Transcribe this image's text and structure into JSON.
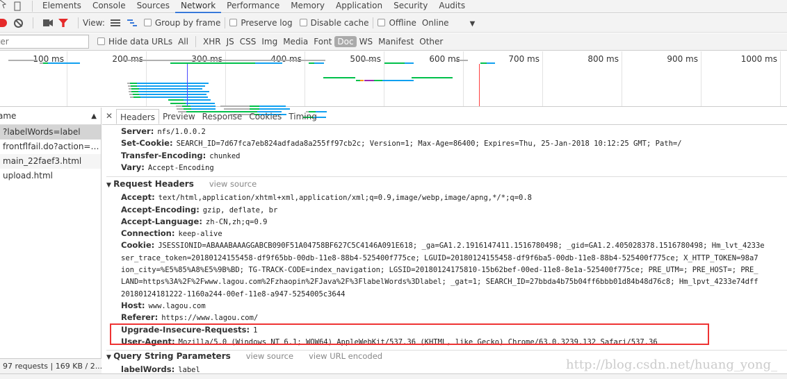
{
  "devtools_tabs": [
    "Elements",
    "Console",
    "Sources",
    "Network",
    "Performance",
    "Memory",
    "Application",
    "Security",
    "Audits"
  ],
  "active_tab": "Network",
  "toolbar": {
    "view_label": "View:",
    "group_by_frame": "Group by frame",
    "preserve_log": "Preserve log",
    "disable_cache": "Disable cache",
    "offline": "Offline",
    "throttle": "Online"
  },
  "filter": {
    "placeholder": "Filter",
    "value": "",
    "hide_data_urls": "Hide data URLs",
    "types": [
      "All",
      "XHR",
      "JS",
      "CSS",
      "Img",
      "Media",
      "Font",
      "Doc",
      "WS",
      "Manifest",
      "Other"
    ],
    "active_type": "Doc"
  },
  "timeline": {
    "ticks": [
      "100 ms",
      "200 ms",
      "300 ms",
      "400 ms",
      "500 ms",
      "600 ms",
      "700 ms",
      "800 ms",
      "900 ms",
      "1000 ms"
    ],
    "dom_content_loaded_ms": 252,
    "load_ms": 620,
    "colors": {
      "wait": "#b0b0b0",
      "ttfb": "#00c04a",
      "download": "#10a0f0",
      "ssl": "#9c27b0",
      "connect": "#ff9800",
      "dcl": "#4b4bff",
      "load": "#ff4040"
    },
    "bars": [
      {
        "row": 0,
        "segs": [
          [
            "wait",
            26,
            63
          ]
        ]
      },
      {
        "row": 0,
        "segs": [
          [
            "wait",
            170,
            426
          ]
        ]
      },
      {
        "row": 0,
        "segs": [
          [
            "wait",
            474,
            489
          ]
        ]
      },
      {
        "row": 0,
        "segs": [
          [
            "wait",
            590,
            606
          ]
        ]
      },
      {
        "row": 1,
        "segs": [
          [
            "wait",
            66,
            70
          ],
          [
            "ttfb",
            70,
            76
          ],
          [
            "download",
            76,
            117
          ]
        ]
      },
      {
        "row": 1,
        "segs": [
          [
            "ttfb",
            231,
            338
          ],
          [
            "download",
            338,
            372
          ]
        ]
      },
      {
        "row": 1,
        "segs": [
          [
            "ttfb",
            405,
            412
          ],
          [
            "download",
            412,
            425
          ]
        ]
      },
      {
        "row": 1,
        "segs": [
          [
            "ttfb",
            501,
            526
          ],
          [
            "download",
            526,
            538
          ]
        ]
      },
      {
        "row": 1,
        "segs": [
          [
            "ttfb",
            622,
            630
          ],
          [
            "download",
            630,
            640
          ]
        ]
      },
      {
        "row": 6,
        "segs": [
          [
            "ttfb",
            424,
            464
          ]
        ]
      },
      {
        "row": 6,
        "segs": [
          [
            "ttfb",
            535,
            587
          ]
        ]
      },
      {
        "row": 7,
        "segs": [
          [
            "ttfb",
            465,
            470
          ],
          [
            "connect",
            470,
            475
          ],
          [
            "ssl",
            475,
            488
          ],
          [
            "ttfb",
            488,
            498
          ],
          [
            "download",
            498,
            538
          ]
        ]
      },
      {
        "row": 8,
        "segs": [
          [
            "wait",
            176,
            180
          ],
          [
            "ttfb",
            180,
            189
          ],
          [
            "download",
            189,
            279
          ]
        ]
      },
      {
        "row": 9,
        "segs": [
          [
            "wait",
            177,
            181
          ],
          [
            "ttfb",
            181,
            189
          ],
          [
            "download",
            189,
            275
          ]
        ]
      },
      {
        "row": 10,
        "segs": [
          [
            "wait",
            178,
            182
          ],
          [
            "ttfb",
            182,
            191
          ],
          [
            "download",
            191,
            271
          ]
        ]
      },
      {
        "row": 11,
        "segs": [
          [
            "wait",
            178,
            182
          ],
          [
            "ttfb",
            182,
            190
          ],
          [
            "download",
            190,
            280
          ]
        ]
      },
      {
        "row": 12,
        "segs": [
          [
            "wait",
            179,
            183
          ],
          [
            "ttfb",
            183,
            191
          ],
          [
            "download",
            191,
            276
          ]
        ]
      },
      {
        "row": 13,
        "segs": [
          [
            "wait",
            180,
            184
          ],
          [
            "ttfb",
            184,
            193
          ],
          [
            "download",
            193,
            278
          ]
        ]
      },
      {
        "row": 14,
        "segs": [
          [
            "ttfb",
            228,
            247
          ],
          [
            "download",
            247,
            282
          ]
        ]
      },
      {
        "row": 15,
        "segs": [
          [
            "ttfb",
            231,
            250
          ],
          [
            "download",
            250,
            287
          ]
        ]
      },
      {
        "row": 16,
        "segs": [
          [
            "wait",
            238,
            246
          ],
          [
            "ttfb",
            246,
            256
          ],
          [
            "download",
            256,
            288
          ]
        ]
      },
      {
        "row": 16,
        "segs": [
          [
            "wait",
            294,
            331
          ],
          [
            "ttfb",
            331,
            343
          ],
          [
            "download",
            343,
            376
          ]
        ]
      },
      {
        "row": 17,
        "segs": [
          [
            "wait",
            239,
            247
          ],
          [
            "ttfb",
            247,
            257
          ],
          [
            "download",
            257,
            288
          ]
        ]
      },
      {
        "row": 17,
        "segs": [
          [
            "wait",
            298,
            331
          ],
          [
            "ttfb",
            331,
            343
          ],
          [
            "download",
            343,
            382
          ]
        ]
      },
      {
        "row": 18,
        "segs": [
          [
            "wait",
            240,
            251
          ],
          [
            "ttfb",
            251,
            340
          ],
          [
            "download",
            340,
            371
          ]
        ]
      },
      {
        "row": 18,
        "segs": [
          [
            "wait",
            402,
            405
          ],
          [
            "ttfb",
            405,
            414
          ],
          [
            "download",
            414,
            428
          ]
        ]
      },
      {
        "row": 19,
        "segs": [
          [
            "wait",
            307,
            337
          ],
          [
            "ttfb",
            337,
            343
          ],
          [
            "download",
            343,
            377
          ]
        ]
      },
      {
        "row": 20,
        "segs": [
          [
            "ttfb",
            398,
            411
          ],
          [
            "download",
            411,
            427
          ]
        ]
      }
    ]
  },
  "requests": {
    "header": "Name",
    "items": [
      "?labelWords=label",
      "frontflfail.do?action=gr...",
      "main_22faef3.html",
      "upload.html"
    ],
    "selected": 0,
    "status": "97 requests | 169 KB / 2..."
  },
  "detail_tabs": [
    "Headers",
    "Preview",
    "Response",
    "Cookies",
    "Timing"
  ],
  "active_detail_tab": "Headers",
  "response_headers": [
    {
      "k": "Server:",
      "v": "nfs/1.0.0.2"
    },
    {
      "k": "Set-Cookie:",
      "v": "SEARCH_ID=7d67fca7eb824adfada8a255ff97cb2c; Version=1; Max-Age=86400; Expires=Thu, 25-Jan-2018 10:12:25 GMT; Path=/"
    },
    {
      "k": "Transfer-Encoding:",
      "v": "chunked"
    },
    {
      "k": "Vary:",
      "v": "Accept-Encoding"
    }
  ],
  "request_section": {
    "title": "Request Headers",
    "view_source": "view source"
  },
  "request_headers": [
    {
      "k": "Accept:",
      "v": "text/html,application/xhtml+xml,application/xml;q=0.9,image/webp,image/apng,*/*;q=0.8"
    },
    {
      "k": "Accept-Encoding:",
      "v": "gzip, deflate, br"
    },
    {
      "k": "Accept-Language:",
      "v": "zh-CN,zh;q=0.9"
    },
    {
      "k": "Connection:",
      "v": "keep-alive"
    },
    {
      "k": "Cookie:",
      "v": "JSESSIONID=ABAAABAAAGGABCB090F51A04758BF627C5C4146A091E618; _ga=GA1.2.1916147411.1516780498; _gid=GA1.2.405028378.1516780498; Hm_lvt_4233e"
    },
    {
      "k": "",
      "v": "ser_trace_token=20180124155458-df9f65bb-00db-11e8-88b4-525400f775ce; LGUID=20180124155458-df9f6ba5-00db-11e8-88b4-525400f775ce; X_HTTP_TOKEN=98a7"
    },
    {
      "k": "",
      "v": "ion_city=%E5%85%A8%E5%9B%BD; TG-TRACK-CODE=index_navigation; LGSID=20180124175810-15b62bef-00ed-11e8-8e1a-525400f775ce; PRE_UTM=; PRE_HOST=; PRE_"
    },
    {
      "k": "",
      "v": "LAND=https%3A%2F%2Fwww.lagou.com%2Fzhaopin%2FJava%2F%3FlabelWords%3Dlabel; _gat=1; SEARCH_ID=27bbda4b75b04ff6bbb01d84b48d76c8; Hm_lpvt_4233e74dff"
    },
    {
      "k": "",
      "v": "20180124181222-1160a244-00ef-11e8-a947-5254005c3644"
    },
    {
      "k": "Host:",
      "v": "www.lagou.com"
    },
    {
      "k": "Referer:",
      "v": "https://www.lagou.com/"
    },
    {
      "k": "Upgrade-Insecure-Requests:",
      "v": "1"
    },
    {
      "k": "User-Agent:",
      "v": "Mozilla/5.0 (Windows NT 6.1; WOW64) AppleWebKit/537.36 (KHTML, like Gecko) Chrome/63.0.3239.132 Safari/537.36"
    }
  ],
  "query_section": {
    "title": "Query String Parameters",
    "view_source": "view source",
    "view_url_encoded": "view URL encoded"
  },
  "query_params": [
    {
      "k": "labelWords:",
      "v": "label"
    }
  ],
  "watermark": "http://blog.csdn.net/huang_yong_",
  "highlight_color": "#ee3333"
}
